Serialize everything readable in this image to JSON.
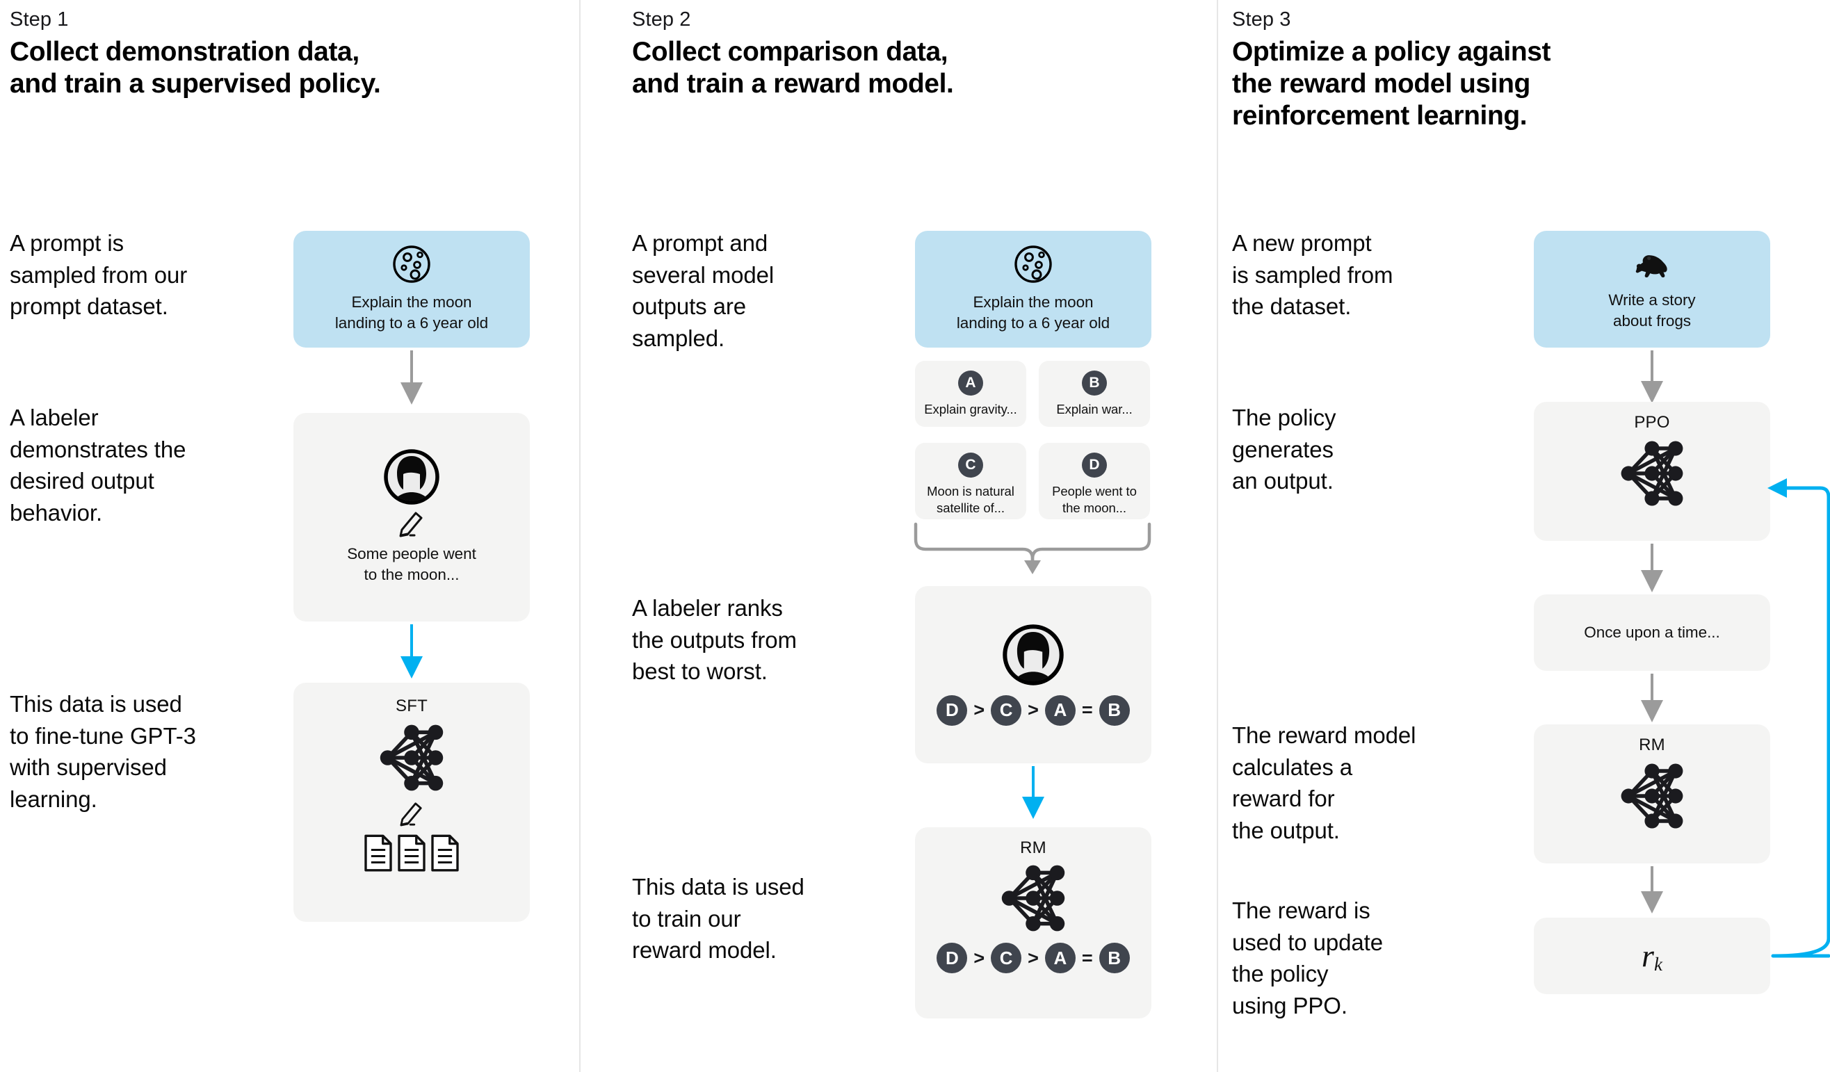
{
  "columns": [
    {
      "step_label": "Step 1",
      "step_title": "Collect demonstration data,\nand train a supervised policy.",
      "paragraphs": [
        "A prompt is\nsampled from our\nprompt dataset.",
        "A labeler\ndemonstrates the\ndesired output\nbehavior.",
        "This data is used\nto fine-tune GPT-3\nwith supervised\nlearning."
      ],
      "prompt_card": {
        "icon": "moon-icon",
        "text": "Explain the moon\nlanding to a 6 year old"
      },
      "labeler_card": {
        "icon": "labeler-avatar-icon",
        "pencil": "pencil-icon",
        "text": "Some people went\nto the moon..."
      },
      "model_card": {
        "title": "SFT",
        "net": "neural-network-icon",
        "pencil": "pencil-icon",
        "docs": "documents-icon"
      }
    },
    {
      "step_label": "Step 2",
      "step_title": "Collect comparison data,\nand train a reward model.",
      "paragraphs": [
        "A prompt and\nseveral model\noutputs are\nsampled.",
        "A labeler ranks\nthe outputs from\nbest to worst.",
        "This data is used\nto train our\nreward model."
      ],
      "prompt_card": {
        "icon": "moon-icon",
        "text": "Explain the moon\nlanding to a 6 year old"
      },
      "outputs": [
        {
          "letter": "A",
          "text": "Explain gravity..."
        },
        {
          "letter": "B",
          "text": "Explain war..."
        },
        {
          "letter": "C",
          "text": "Moon is natural\nsatellite of..."
        },
        {
          "letter": "D",
          "text": "People went to\nthe moon..."
        }
      ],
      "ranking_card": {
        "icon": "labeler-avatar-icon",
        "ranking": [
          "D",
          ">",
          "C",
          ">",
          "A",
          "=",
          "B"
        ]
      },
      "reward_card": {
        "title": "RM",
        "net": "neural-network-icon",
        "ranking": [
          "D",
          ">",
          "C",
          ">",
          "A",
          "=",
          "B"
        ]
      }
    },
    {
      "step_label": "Step 3",
      "step_title": "Optimize a policy against\nthe reward model using\nreinforcement learning.",
      "paragraphs": [
        "A new prompt\nis sampled from\nthe dataset.",
        "The policy\ngenerates\nan output.",
        "The reward model\ncalculates a\nreward for\nthe output.",
        "The reward is\nused to update\nthe policy\nusing PPO."
      ],
      "prompt_card": {
        "icon": "frog-icon",
        "text": "Write a story\nabout frogs"
      },
      "ppo_card": {
        "title": "PPO",
        "net": "neural-network-icon"
      },
      "output_card": {
        "text": "Once upon a time..."
      },
      "rm_card": {
        "title": "RM",
        "net": "neural-network-icon"
      },
      "reward_card": {
        "symbol": "r",
        "subscript": "k"
      }
    }
  ],
  "colors": {
    "prompt_blue": "#bfe1f2",
    "card_gray": "#f4f4f3",
    "badge_dark": "#40454e",
    "arrow_gray": "#9b9b9b",
    "arrow_blue": "#00b0f0",
    "divider": "#e6e6e6",
    "text": "#0a0a0a"
  }
}
